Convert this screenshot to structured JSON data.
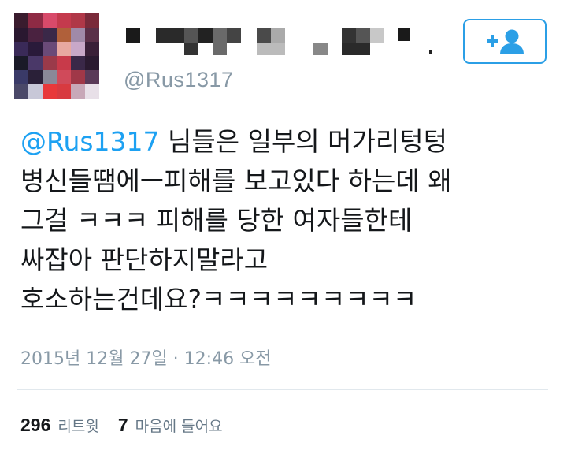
{
  "user": {
    "handle": "@Rus1317"
  },
  "follow_button": {
    "icon": "add-user-icon",
    "color": "#2b9fe6"
  },
  "tweet": {
    "mention": "@Rus1317",
    "lines": [
      " 님들은 일부의 머가리텅텅",
      "병신들땜에ㅡ피해를 보고있다 하는데 왜",
      "그걸 ㅋㅋㅋ 피해를 당한 여자들한테",
      "싸잡아 판단하지말라고",
      "호소하는건데요?ㅋㅋㅋㅋㅋㅋㅋㅋㅋ"
    ],
    "timestamp": "2015년 12월 27일 · 12:46 오전"
  },
  "stats": {
    "retweets_count": "296",
    "retweets_label": "리트윗",
    "likes_count": "7",
    "likes_label": "마음에 들어요"
  },
  "colors": {
    "link": "#1da1f2",
    "secondary_text": "#8899a6",
    "divider": "#e1e8ed"
  }
}
